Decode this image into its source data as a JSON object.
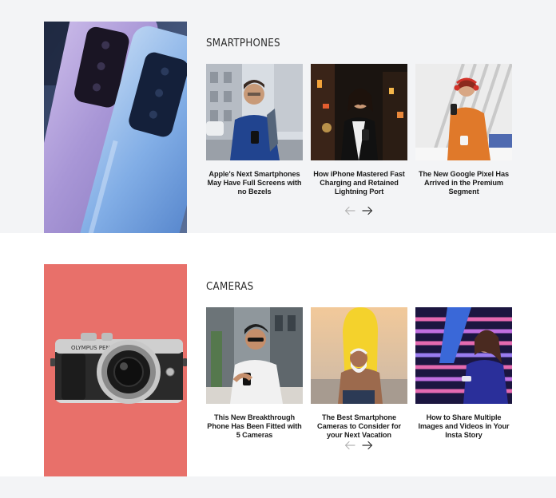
{
  "sections": [
    {
      "title": "SMARTPHONES",
      "articles": [
        {
          "title": "Apple's Next Smartphones May Have Full Screens with no Bezels"
        },
        {
          "title": "How iPhone Mastered Fast Charging and Retained Lightning Port"
        },
        {
          "title": "The New Google Pixel Has Arrived in the Premium Segment"
        }
      ]
    },
    {
      "title": "CAMERAS",
      "articles": [
        {
          "title": "This New Breakthrough Phone Has Been Fitted with 5 Cameras"
        },
        {
          "title": "The Best Smartphone Cameras to Consider for your Next Vacation"
        },
        {
          "title": "How to Share Multiple Images and Videos in Your Insta Story"
        }
      ]
    }
  ],
  "camera_brand": "OLYMPUS PEN",
  "colors": {
    "page_bg": "#f3f4f6",
    "section_alt_bg": "#ffffff",
    "camera_bg": "#e8706a",
    "arrow_inactive": "#b5b5b5",
    "arrow_active": "#333333"
  },
  "icons": [
    "arrow-left-icon",
    "arrow-right-icon"
  ]
}
